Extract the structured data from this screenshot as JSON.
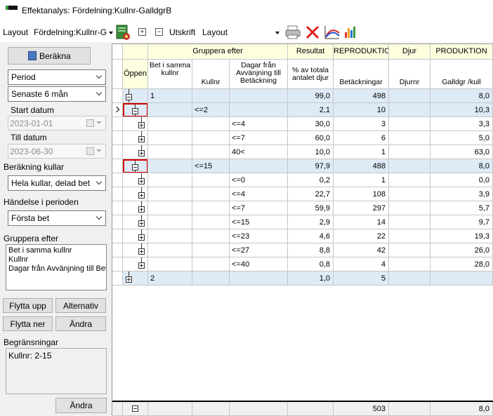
{
  "window": {
    "title": "Effektanalys: Fördelning:Kullnr-GalldgrB"
  },
  "toolbar": {
    "layout_label": "Layout",
    "layout_value": "Fördelning:Kullnr-G",
    "expand_symbol": "+",
    "collapse_symbol": "−",
    "print_label": "Utskrift",
    "print_layout_value": "Layout"
  },
  "left": {
    "calc_button": "Beräkna",
    "period_type": "Period",
    "period_value": "Senaste 6 mån",
    "start_label": "Start datum",
    "start_value": "2023-01-01",
    "end_label": "Till datum",
    "end_value": "2023-06-30",
    "litter_calc_label": "Beräkning kullar",
    "litter_calc_value": "Hela kullar, delad bet",
    "event_label": "Händelse i perioden",
    "event_value": "Första bet",
    "group_label": "Gruppera efter",
    "group_items": [
      "Bet i samma kullnr",
      "Kullnr",
      "Dagar från Avvänjning till Betäckning"
    ],
    "move_up": "Flytta upp",
    "alternative": "Alternativ",
    "move_down": "Flytta ner",
    "change": "Ändra",
    "limits_label": "Begränsningar",
    "limits_items": [
      "Kullnr: 2-15"
    ],
    "limits_change": "Ändra"
  },
  "grid": {
    "headers": {
      "open": "Öppen",
      "group_by": "Gruppera efter",
      "bet_same": "Bet i samma kullnr",
      "kullnr": "Kullnr",
      "days": "Dagar från Avvänjning till Betäckning",
      "result": "Resultat",
      "pct": "% av totala antalet djur",
      "repro": "REPRODUKTIO",
      "matings": "Betäckningar",
      "animal": "Djur",
      "sow_nr": "Djurnr",
      "prod": "PRODUKTION",
      "galldgr": "Galldgr /kull"
    },
    "rows": [
      {
        "level": 0,
        "bet": "1",
        "kullnr": "",
        "days": "",
        "pct": "99,0",
        "bet_count": "498",
        "sow": "",
        "gall": "8,0",
        "expanded": true,
        "marker": false,
        "highlight": false
      },
      {
        "level": 1,
        "bet": "",
        "kullnr": "<=2",
        "days": "",
        "pct": "2,1",
        "bet_count": "10",
        "sow": "",
        "gall": "10,3",
        "expanded": true,
        "marker": true,
        "highlight": true
      },
      {
        "level": 2,
        "bet": "",
        "kullnr": "",
        "days": "<=4",
        "pct": "30,0",
        "bet_count": "3",
        "sow": "",
        "gall": "3,3",
        "expanded": false,
        "marker": false,
        "highlight": false
      },
      {
        "level": 2,
        "bet": "",
        "kullnr": "",
        "days": "<=7",
        "pct": "60,0",
        "bet_count": "6",
        "sow": "",
        "gall": "5,0",
        "expanded": false,
        "marker": false,
        "highlight": false
      },
      {
        "level": 2,
        "bet": "",
        "kullnr": "",
        "days": "40<",
        "pct": "10,0",
        "bet_count": "1",
        "sow": "",
        "gall": "63,0",
        "expanded": false,
        "marker": false,
        "highlight": false
      },
      {
        "level": 1,
        "bet": "",
        "kullnr": "<=15",
        "days": "",
        "pct": "97,9",
        "bet_count": "488",
        "sow": "",
        "gall": "8,0",
        "expanded": true,
        "marker": false,
        "highlight": true
      },
      {
        "level": 2,
        "bet": "",
        "kullnr": "",
        "days": "<=0",
        "pct": "0,2",
        "bet_count": "1",
        "sow": "",
        "gall": "0,0",
        "expanded": false,
        "marker": false,
        "highlight": false
      },
      {
        "level": 2,
        "bet": "",
        "kullnr": "",
        "days": "<=4",
        "pct": "22,7",
        "bet_count": "108",
        "sow": "",
        "gall": "3,9",
        "expanded": false,
        "marker": false,
        "highlight": false
      },
      {
        "level": 2,
        "bet": "",
        "kullnr": "",
        "days": "<=7",
        "pct": "59,9",
        "bet_count": "297",
        "sow": "",
        "gall": "5,7",
        "expanded": false,
        "marker": false,
        "highlight": false
      },
      {
        "level": 2,
        "bet": "",
        "kullnr": "",
        "days": "<=15",
        "pct": "2,9",
        "bet_count": "14",
        "sow": "",
        "gall": "9,7",
        "expanded": false,
        "marker": false,
        "highlight": false
      },
      {
        "level": 2,
        "bet": "",
        "kullnr": "",
        "days": "<=23",
        "pct": "4,6",
        "bet_count": "22",
        "sow": "",
        "gall": "19,3",
        "expanded": false,
        "marker": false,
        "highlight": false
      },
      {
        "level": 2,
        "bet": "",
        "kullnr": "",
        "days": "<=27",
        "pct": "8,8",
        "bet_count": "42",
        "sow": "",
        "gall": "26,0",
        "expanded": false,
        "marker": false,
        "highlight": false
      },
      {
        "level": 2,
        "bet": "",
        "kullnr": "",
        "days": "<=40",
        "pct": "0,8",
        "bet_count": "4",
        "sow": "",
        "gall": "28,0",
        "expanded": false,
        "marker": false,
        "highlight": false
      },
      {
        "level": 0,
        "bet": "2",
        "kullnr": "",
        "days": "",
        "pct": "1,0",
        "bet_count": "5",
        "sow": "",
        "gall": "",
        "expanded": false,
        "marker": false,
        "highlight": false
      }
    ],
    "footer": {
      "bet_count": "503",
      "gall": "8,0"
    }
  },
  "colors": {
    "header_bg": "#ffffe0",
    "group_row_bg": "#deebf7",
    "highlight_border": "#d00000",
    "accent_green": "#3a9a3a"
  }
}
